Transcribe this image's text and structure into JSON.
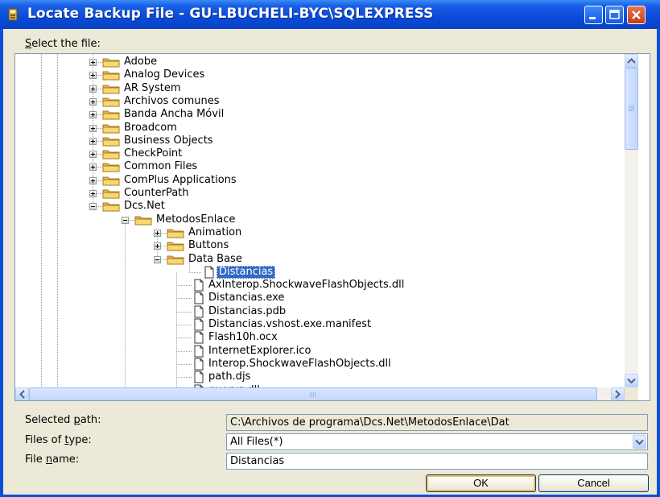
{
  "window": {
    "title": "Locate Backup File - GU-LBUCHELI-BYC\\SQLEXPRESS"
  },
  "dialog": {
    "select_label": "Select the file:",
    "tree": [
      {
        "label": "Adobe",
        "type": "folder",
        "depth": 0,
        "expander": "plus"
      },
      {
        "label": "Analog Devices",
        "type": "folder",
        "depth": 0,
        "expander": "plus"
      },
      {
        "label": "AR System",
        "type": "folder",
        "depth": 0,
        "expander": "plus"
      },
      {
        "label": "Archivos comunes",
        "type": "folder",
        "depth": 0,
        "expander": "plus"
      },
      {
        "label": "Banda Ancha Móvil",
        "type": "folder",
        "depth": 0,
        "expander": "plus"
      },
      {
        "label": "Broadcom",
        "type": "folder",
        "depth": 0,
        "expander": "plus"
      },
      {
        "label": "Business Objects",
        "type": "folder",
        "depth": 0,
        "expander": "plus"
      },
      {
        "label": "CheckPoint",
        "type": "folder",
        "depth": 0,
        "expander": "plus"
      },
      {
        "label": "Common Files",
        "type": "folder",
        "depth": 0,
        "expander": "plus"
      },
      {
        "label": "ComPlus Applications",
        "type": "folder",
        "depth": 0,
        "expander": "plus"
      },
      {
        "label": "CounterPath",
        "type": "folder",
        "depth": 0,
        "expander": "plus"
      },
      {
        "label": "Dcs.Net",
        "type": "folder",
        "depth": 0,
        "expander": "minus"
      },
      {
        "label": "MetodosEnlace",
        "type": "folder",
        "depth": 1,
        "expander": "minus"
      },
      {
        "label": "Animation",
        "type": "folder",
        "depth": 2,
        "expander": "plus"
      },
      {
        "label": "Buttons",
        "type": "folder",
        "depth": 2,
        "expander": "plus"
      },
      {
        "label": "Data Base",
        "type": "folder",
        "depth": 2,
        "expander": "minus"
      },
      {
        "label": "Distancias",
        "type": "file",
        "depth": 3,
        "expander": "none",
        "selected": true
      },
      {
        "label": "AxInterop.ShockwaveFlashObjects.dll",
        "type": "file",
        "depth": 2,
        "expander": "none"
      },
      {
        "label": "Distancias.exe",
        "type": "file",
        "depth": 2,
        "expander": "none"
      },
      {
        "label": "Distancias.pdb",
        "type": "file",
        "depth": 2,
        "expander": "none"
      },
      {
        "label": "Distancias.vshost.exe.manifest",
        "type": "file",
        "depth": 2,
        "expander": "none"
      },
      {
        "label": "Flash10h.ocx",
        "type": "file",
        "depth": 2,
        "expander": "none"
      },
      {
        "label": "InternetExplorer.ico",
        "type": "file",
        "depth": 2,
        "expander": "none"
      },
      {
        "label": "Interop.ShockwaveFlashObjects.dll",
        "type": "file",
        "depth": 2,
        "expander": "none"
      },
      {
        "label": "path.djs",
        "type": "file",
        "depth": 2,
        "expander": "none"
      },
      {
        "label": "querys.dll",
        "type": "file",
        "depth": 2,
        "expander": "none"
      }
    ],
    "selected_path_label": "Selected path:",
    "selected_path_value": "C:\\Archivos de programa\\Dcs.Net\\MetodosEnlace\\Dat",
    "files_of_type_label": "Files of type:",
    "files_of_type_value": "All Files(*)",
    "file_name_label": "File name:",
    "file_name_value": "Distancias",
    "ok_label": "OK",
    "cancel_label": "Cancel"
  },
  "colors": {
    "titlebar": "#0a4bd8",
    "selection": "#316ac5",
    "dialog_bg": "#ece9d8"
  }
}
